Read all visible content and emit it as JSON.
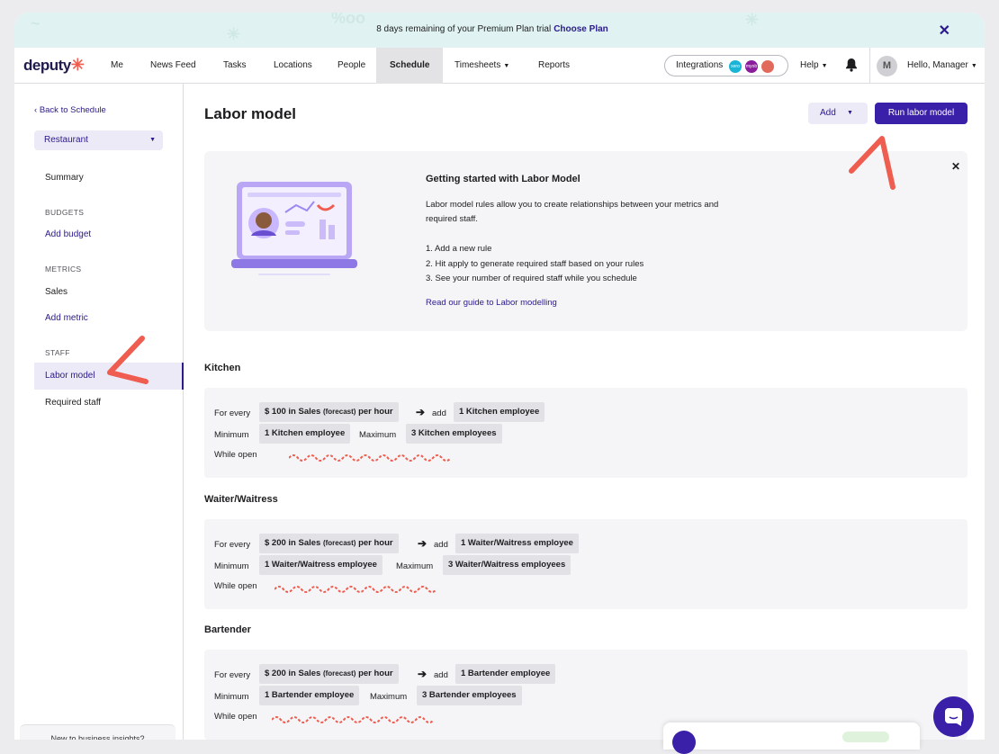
{
  "banner": {
    "text": "8 days remaining of your Premium Plan trial",
    "link": "Choose Plan",
    "close": "✕"
  },
  "nav": {
    "logo": "deputy",
    "items": [
      "Me",
      "News Feed",
      "Tasks",
      "Locations",
      "People",
      "Schedule",
      "Timesheets",
      "Reports"
    ],
    "active": "Schedule",
    "integrations": "Integrations",
    "integration_badges": [
      "xero",
      "myob",
      "quickbooks"
    ],
    "help": "Help",
    "avatar_initial": "M",
    "greeting": "Hello, Manager"
  },
  "sidebar": {
    "back": "Back to Schedule",
    "location": "Restaurant",
    "summary": "Summary",
    "budgets_heading": "BUDGETS",
    "add_budget": "Add budget",
    "metrics_heading": "METRICS",
    "sales": "Sales",
    "add_metric": "Add metric",
    "staff_heading": "STAFF",
    "labor_model": "Labor model",
    "required_staff": "Required staff",
    "bottom_text": "New to business insights?"
  },
  "main": {
    "title": "Labor model",
    "add_button": "Add",
    "run_button": "Run labor model",
    "intro": {
      "title": "Getting started with Labor Model",
      "desc": "Labor model rules allow you to create relationships between your metrics and required staff.",
      "steps": [
        "1. Add a new rule",
        "2. Hit apply to generate required staff based on your rules",
        "3. See your number of required staff while you schedule"
      ],
      "link": "Read our guide to Labor modelling",
      "close": "✕"
    },
    "labels": {
      "for_every": "For every",
      "add": "add",
      "minimum": "Minimum",
      "maximum": "Maximum",
      "while_open": "While open",
      "arrow": "➔"
    },
    "roles": [
      {
        "name": "Kitchen",
        "rate_pre": "$ 100 in Sales",
        "rate_mid": "(forecast)",
        "rate_post": "per hour",
        "add_val": "1 Kitchen employee",
        "min_val": "1 Kitchen employee",
        "max_val": "3 Kitchen employees"
      },
      {
        "name": "Waiter/Waitress",
        "rate_pre": "$ 200 in Sales",
        "rate_mid": "(forecast)",
        "rate_post": "per hour",
        "add_val": "1 Waiter/Waitress employee",
        "min_val": "1 Waiter/Waitress employee",
        "max_val": "3 Waiter/Waitress employees"
      },
      {
        "name": "Bartender",
        "rate_pre": "$ 200 in Sales",
        "rate_mid": "(forecast)",
        "rate_post": "per hour",
        "add_val": "1 Bartender employee",
        "min_val": "1 Bartender employee",
        "max_val": "3 Bartender employees"
      }
    ]
  },
  "colors": {
    "brand": "#3a1fa8",
    "link": "#2a1a8c",
    "annotation": "#ee5d4f",
    "banner_bg": "#e0f3f2",
    "panel_bg": "#f5f5f7"
  }
}
